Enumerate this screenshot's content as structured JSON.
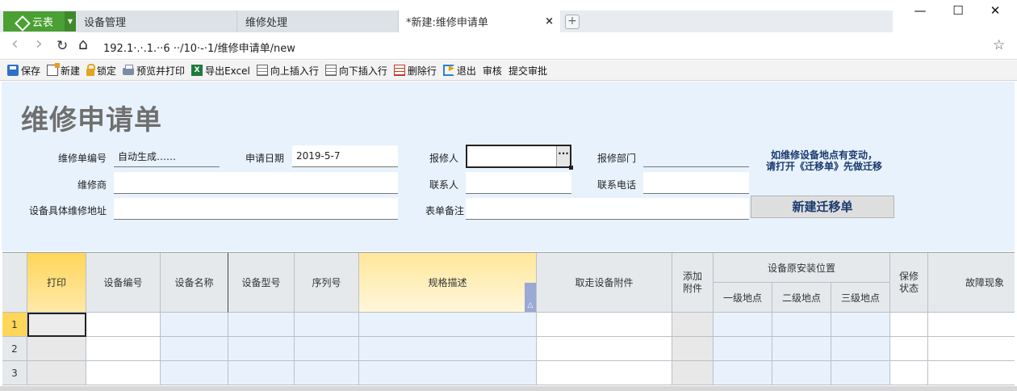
{
  "browser": {
    "app_label": "云表",
    "tabs": [
      {
        "label": "设备管理",
        "active": false
      },
      {
        "label": "维修处理",
        "active": false
      },
      {
        "label": "*新建:维修申请单",
        "active": true
      }
    ],
    "tab_close": "×",
    "new_tab": "+",
    "window_controls": {
      "minimize": "—",
      "maximize": "☐",
      "close": "✕"
    },
    "nav": {
      "back": "‹",
      "forward": "›",
      "reload": "↻",
      "home": "⌂"
    },
    "url": "192.1·.·.1.··6 ··/10·-·1/维修申请单/new",
    "bookmark_icon": "star-icon"
  },
  "toolbar": {
    "items": [
      {
        "label": "保存",
        "icon": "save-icon"
      },
      {
        "label": "新建",
        "icon": "new-icon"
      },
      {
        "label": "锁定",
        "icon": "lock-icon"
      },
      {
        "label": "预览并打印",
        "icon": "print-icon"
      },
      {
        "label": "导出Excel",
        "icon": "excel-icon"
      },
      {
        "label": "向上插入行",
        "icon": "insert-above-icon"
      },
      {
        "label": "向下插入行",
        "icon": "insert-below-icon"
      },
      {
        "label": "删除行",
        "icon": "delete-row-icon"
      },
      {
        "label": "退出",
        "icon": "exit-icon"
      },
      {
        "label": "审核",
        "icon": ""
      },
      {
        "label": "提交审批",
        "icon": ""
      }
    ]
  },
  "form": {
    "title": "维修申请单",
    "fields": {
      "order_no": {
        "label": "维修单编号",
        "value": "自动生成……"
      },
      "apply_date": {
        "label": "申请日期",
        "value": "2019-5-7"
      },
      "reporter": {
        "label": "报修人",
        "value": "",
        "button": "···"
      },
      "report_dept": {
        "label": "报修部门",
        "value": ""
      },
      "vendor": {
        "label": "维修商",
        "value": ""
      },
      "contact": {
        "label": "联系人",
        "value": ""
      },
      "phone": {
        "label": "联系电话",
        "value": ""
      },
      "address": {
        "label": "设备具体维修地址",
        "value": ""
      },
      "remark": {
        "label": "表单备注",
        "value": ""
      }
    },
    "note_line1": "如维修设备地点有变动，",
    "note_line2": "请打开《迁移单》先做迁移",
    "migrate_button": "新建迁移单"
  },
  "grid": {
    "columns": [
      "打印",
      "设备编号",
      "设备名称",
      "设备型号",
      "序列号",
      "规格描述",
      "取走设备附件",
      "添加附件",
      "设备原安装位置",
      "保修状态",
      "故障现象"
    ],
    "location_subcolumns": [
      "一级地点",
      "二级地点",
      "三级地点"
    ],
    "sort_indicator": "△",
    "row_numbers": [
      "1",
      "2",
      "3"
    ]
  }
}
